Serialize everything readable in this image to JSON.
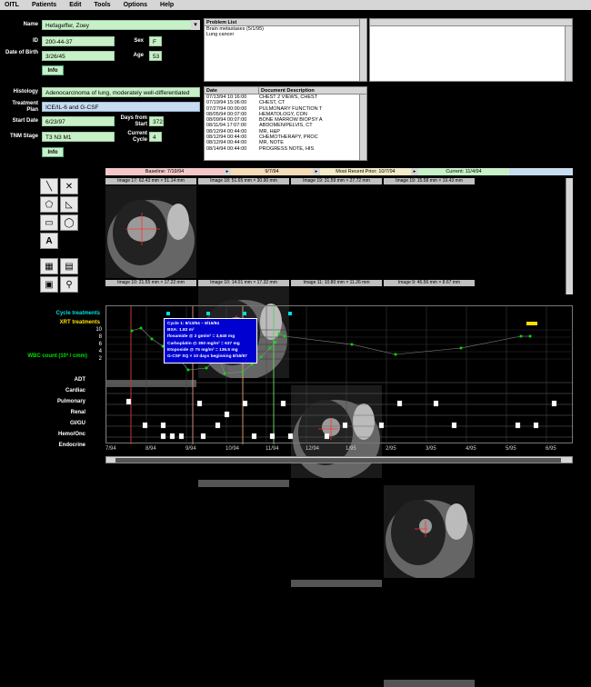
{
  "menu": [
    "OITL",
    "Patients",
    "Edit",
    "Tools",
    "Options",
    "Help"
  ],
  "patient": {
    "name_label": "Name",
    "name": "Hefageffer, Zoey",
    "id_label": "ID",
    "id": "200-44-37",
    "sex_label": "Sex",
    "sex": "F",
    "dob_label": "Date of Birth",
    "dob": "3/26/45",
    "age_label": "Age",
    "age": "53",
    "info_label": "Info",
    "histology_label": "Histology",
    "histology": "Adenocarcinoma of lung, moderately well-differentiated",
    "plan_label": "Treatment Plan",
    "plan": "ICE/IL-6 and G-CSF",
    "start_label": "Start Date",
    "start": "6/23/97",
    "days_label": "Days from Start",
    "days": "372",
    "tnm_label": "TNM Stage",
    "tnm": "T3 N3 M1",
    "cycle_label": "Current Cycle",
    "cycle": "4",
    "info2_label": "Info"
  },
  "problem_list": {
    "header": "Problem List",
    "items": [
      "Brain metastases (5/1/95)",
      "Lung cancer"
    ]
  },
  "documents": {
    "date_header": "Date",
    "desc_header": "Document Description",
    "rows": [
      [
        "07/13/94 10:16:00",
        "CHEST 2 VIEWS, CHEST"
      ],
      [
        "07/19/94 15:06:00",
        "CHEST, CT"
      ],
      [
        "07/27/94 00:00:00",
        "PULMONARY FUNCTION T"
      ],
      [
        "08/05/94 00:07:00",
        "HEMATOLOGY, CON"
      ],
      [
        "08/09/94 00:07:00",
        "BONE MARROW BIOPSY A"
      ],
      [
        "08/11/94 17:07:00",
        "ABDOMEN/PELVIS, CT"
      ],
      [
        "08/12/94 00:44:00",
        "MR, H&P"
      ],
      [
        "08/12/94 00:44:00",
        "CHEMOTHERAPY, PROC"
      ],
      [
        "08/12/94 00:44:00",
        "MR, NOTE"
      ],
      [
        "08/14/94 00:44:00",
        "PROGRESS NOTE, HIS"
      ]
    ]
  },
  "image_tabs": [
    "Baseline: 7/19/94",
    "9/7/94",
    "Most Recent Prior: 10/7/94",
    "Current: 11/4/94"
  ],
  "image_captions_top": [
    "Image 17: 62.43 mm × 51.14 mm",
    "Image 18: 51.65 mm × 30.90 mm",
    "Image 19: 31.59 mm × 27.72 mm",
    "Image 19: 15.58 mm × 19.43 mm"
  ],
  "image_captions_bottom": [
    "Image 10: 21.55 mm × 17.22 mm",
    "Image 10: 14.01 mm × 17.32 mm",
    "Image 11: 10.80 mm × 11.26 mm",
    "Image 9: 46.56 mm × 8.67 mm"
  ],
  "timeline": {
    "cycle_label": "Cycle treatments",
    "xrt_label": "XRT treatments",
    "wbc_label": "WBC count (10³ / cmm)",
    "wbc_ticks": [
      "10",
      "8",
      "6",
      "4",
      "2"
    ],
    "rows": [
      "ADT",
      "Cardiac",
      "Pulmonary",
      "Renal",
      "GI/GU",
      "Hemo/Onc",
      "Endocrine"
    ],
    "xticks": [
      "7/94",
      "8/94",
      "9/94",
      "10/94",
      "11/94",
      "12/94",
      "1/95",
      "2/95",
      "3/95",
      "4/95",
      "5/95",
      "6/95"
    ],
    "tooltip": [
      "Cycle 1: 8/13/94 – 8/15/94",
      "BSA: 1.82 m²",
      "Ifosamide @ 2 gm/m² = 3,640 mg",
      "Carboplatin @ 350 mg/m² = 637 mg",
      "Etoposide @ 75 mg/m² = 136.5 mg",
      "G-CSF SQ × 10 days beginning 8/16/97"
    ]
  },
  "colors": {
    "field_green": "#c8f0c8",
    "field_blue": "#c8dcf0",
    "cycle_cyan": "#00e0e0",
    "xrt_yellow": "#ffe000",
    "wbc_green": "#00e000",
    "tooltip_blue": "#0000d0"
  }
}
